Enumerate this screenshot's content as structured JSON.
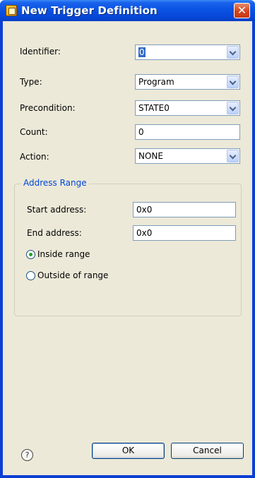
{
  "window": {
    "title": "New Trigger Definition",
    "close_glyph": "✕"
  },
  "form": {
    "identifier": {
      "label": "Identifier:",
      "value": "0"
    },
    "type": {
      "label": "Type:",
      "value": "Program"
    },
    "precondition": {
      "label": "Precondition:",
      "value": "STATE0"
    },
    "count": {
      "label": "Count:",
      "value": "0"
    },
    "action": {
      "label": "Action:",
      "value": "NONE"
    }
  },
  "address_range": {
    "title": "Address Range",
    "start": {
      "label": "Start address:",
      "value": "0x0"
    },
    "end": {
      "label": "End address:",
      "value": "0x0"
    },
    "inside": {
      "label": "Inside range",
      "checked": true
    },
    "outside": {
      "label": "Outside of range",
      "checked": false
    }
  },
  "footer": {
    "help_glyph": "?",
    "ok_label": "OK",
    "cancel_label": "Cancel"
  },
  "icons": [
    "app-icon",
    "close-icon",
    "chevron-down-icon",
    "help-icon",
    "radio-icon"
  ],
  "colors": {
    "titlebar": "#0a53e3",
    "dialog_bg": "#ece9d8",
    "group_title": "#0046d5",
    "selection": "#316ac5"
  }
}
